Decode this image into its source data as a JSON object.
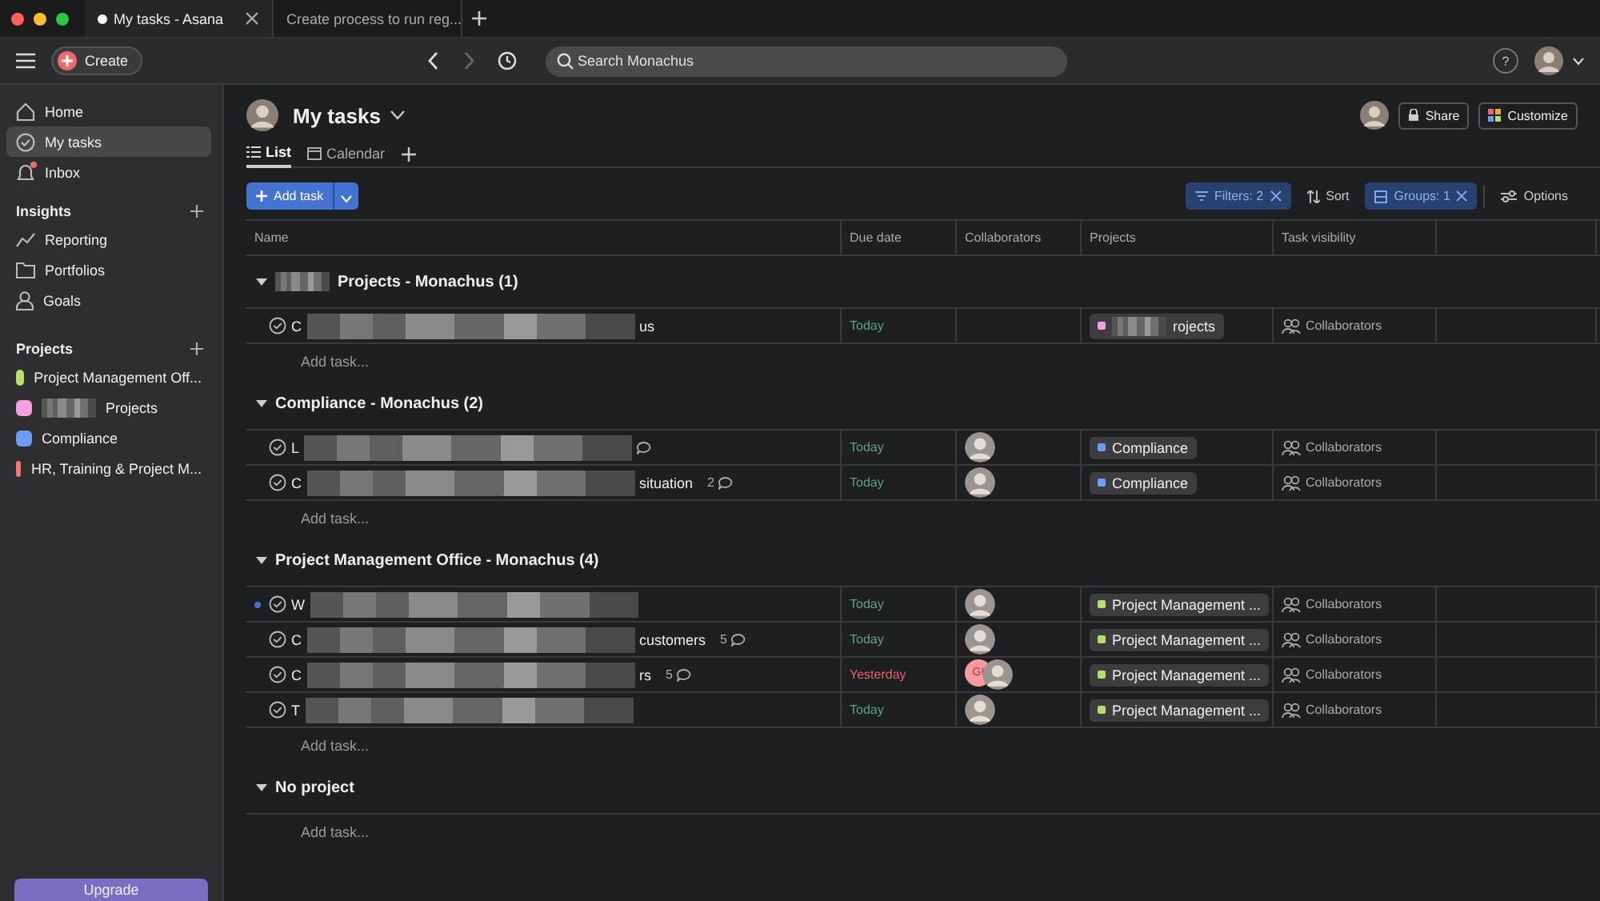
{
  "browser_tabs": [
    {
      "title": "My tasks - Asana",
      "selected": true
    },
    {
      "title": "Create process to run reg...",
      "selected": false
    }
  ],
  "topbar": {
    "create": "Create",
    "search_placeholder": "Search Monachus",
    "help": "?"
  },
  "sidebar": {
    "items": [
      {
        "label": "Home",
        "selected": false
      },
      {
        "label": "My tasks",
        "selected": true
      },
      {
        "label": "Inbox",
        "selected": false,
        "badge": true
      }
    ],
    "sections": [
      {
        "title": "Insights",
        "items": [
          {
            "label": "Reporting"
          },
          {
            "label": "Portfolios"
          },
          {
            "label": "Goals"
          }
        ]
      },
      {
        "title": "Projects",
        "items": [
          {
            "label": "Project Management Off...",
            "color": "#b5e06d"
          },
          {
            "label": "Projects",
            "redacted": true,
            "color": "#f59ee0"
          },
          {
            "label": "Compliance",
            "color": "#6d9ef5"
          },
          {
            "label": "HR, Training & Project M...",
            "color": "#f27474"
          }
        ]
      }
    ],
    "upgrade": "Upgrade"
  },
  "header": {
    "title": "My tasks",
    "share": "Share",
    "customize": "Customize",
    "views": [
      {
        "label": "List",
        "selected": true
      },
      {
        "label": "Calendar",
        "selected": false
      }
    ]
  },
  "toolbar": {
    "add_task": "Add task",
    "filters": "Filters: 2",
    "sort": "Sort",
    "groups": "Groups: 1",
    "options": "Options"
  },
  "table": {
    "columns": [
      "Name",
      "Due date",
      "Collaborators",
      "Projects",
      "Task visibility"
    ],
    "groups": [
      {
        "title": "Projects - Monachus (1)",
        "redacted": true,
        "add_task": "Add task...",
        "rows": [
          {
            "name_start": "C",
            "name_end": "us",
            "completed": false,
            "due": "Today",
            "overdue": false,
            "collaborators": [],
            "project": {
              "label": "rojects",
              "redacted": true,
              "color": "#f59ee0"
            },
            "visibility": "Collaborators",
            "unread": false
          }
        ]
      },
      {
        "title": "Compliance - Monachus (2)",
        "add_task": "Add task...",
        "rows": [
          {
            "name_start": "L",
            "completed": false,
            "comment_icon": true,
            "due": "Today",
            "overdue": false,
            "collaborators": [
              {
                "kind": "photo"
              }
            ],
            "project": {
              "label": "Compliance",
              "color": "#6d9ef5"
            },
            "visibility": "Collaborators",
            "unread": false
          },
          {
            "name_start": "C",
            "name_end": "situation",
            "completed": false,
            "comments": "2",
            "comment_icon": true,
            "due": "Today",
            "overdue": false,
            "collaborators": [
              {
                "kind": "photo"
              }
            ],
            "project": {
              "label": "Compliance",
              "color": "#6d9ef5"
            },
            "visibility": "Collaborators",
            "unread": false
          }
        ]
      },
      {
        "title": "Project Management Office - Monachus (4)",
        "add_task": "Add task...",
        "rows": [
          {
            "name_start": "W",
            "completed": false,
            "due": "Today",
            "overdue": false,
            "collaborators": [
              {
                "kind": "photo"
              }
            ],
            "project": {
              "label": "Project Management ...",
              "color": "#b5e06d"
            },
            "visibility": "Collaborators",
            "unread": true
          },
          {
            "name_start": "C",
            "name_end": "customers",
            "completed": false,
            "comments": "5",
            "comment_icon": true,
            "due": "Today",
            "overdue": false,
            "collaborators": [
              {
                "kind": "photo"
              }
            ],
            "project": {
              "label": "Project Management ...",
              "color": "#b5e06d"
            },
            "visibility": "Collaborators",
            "unread": false
          },
          {
            "name_start": "C",
            "name_end": "rs",
            "completed": false,
            "comments": "5",
            "comment_icon": true,
            "due": "Yesterday",
            "overdue": true,
            "collaborators": [
              {
                "kind": "initials",
                "text": "GI"
              },
              {
                "kind": "photo"
              }
            ],
            "project": {
              "label": "Project Management ...",
              "color": "#b5e06d"
            },
            "visibility": "Collaborators",
            "unread": false
          },
          {
            "name_start": "T",
            "completed": false,
            "due": "Today",
            "overdue": false,
            "collaborators": [
              {
                "kind": "photo"
              }
            ],
            "project": {
              "label": "Project Management ...",
              "color": "#b5e06d"
            },
            "visibility": "Collaborators",
            "unread": false
          }
        ]
      },
      {
        "title": "No project",
        "add_task": "Add task..."
      }
    ]
  }
}
